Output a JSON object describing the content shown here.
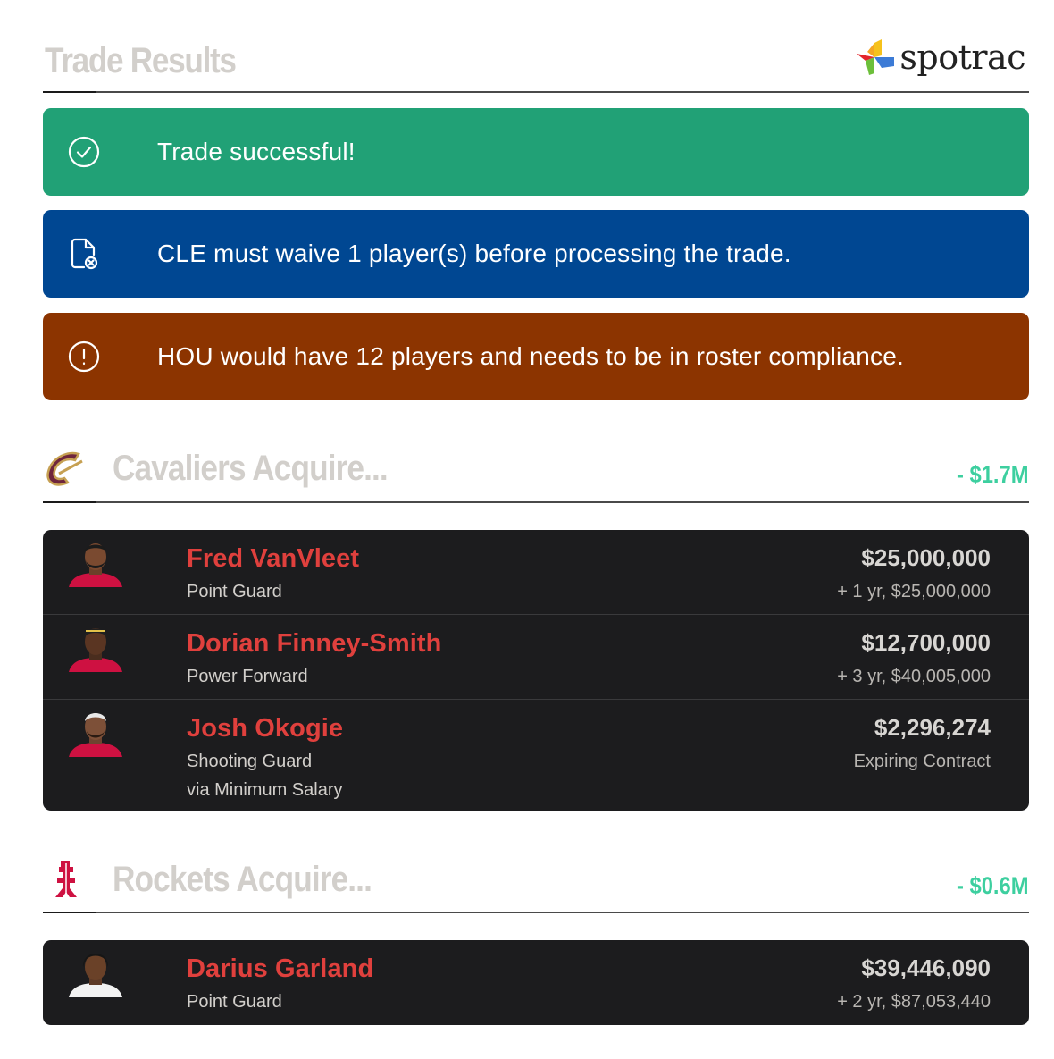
{
  "header": {
    "title": "Trade Results",
    "logo_text": "spotrac"
  },
  "alerts": [
    {
      "type": "success",
      "icon": "check-circle-icon",
      "message": "Trade successful!"
    },
    {
      "type": "info",
      "icon": "file-x-icon",
      "message": "CLE must waive 1 player(s) before processing the trade."
    },
    {
      "type": "warning",
      "icon": "exclamation-circle-icon",
      "message": "HOU would have 12 players and needs to be in roster compliance."
    }
  ],
  "sections": [
    {
      "team": "Cavaliers",
      "title": "Cavaliers Acquire...",
      "net": "- $1.7M",
      "players": [
        {
          "name": "Fred VanVleet",
          "position": "Point Guard",
          "salary": "$25,000,000",
          "extension": "+ 1 yr, $25,000,000"
        },
        {
          "name": "Dorian Finney-Smith",
          "position": "Power Forward",
          "salary": "$12,700,000",
          "extension": "+ 3 yr, $40,005,000"
        },
        {
          "name": "Josh Okogie",
          "position": "Shooting Guard",
          "note": "via Minimum Salary",
          "salary": "$2,296,274",
          "extension": "Expiring Contract"
        }
      ]
    },
    {
      "team": "Rockets",
      "title": "Rockets Acquire...",
      "net": "- $0.6M",
      "players": [
        {
          "name": "Darius Garland",
          "position": "Point Guard",
          "salary": "$39,446,090",
          "extension": "+ 2 yr, $87,053,440"
        }
      ]
    }
  ],
  "colors": {
    "success": "#21a176",
    "info": "#004792",
    "warning": "#8c3400",
    "player_name": "#e0403d",
    "net_change": "#3dcf9f",
    "card_bg": "#1c1c1e"
  }
}
